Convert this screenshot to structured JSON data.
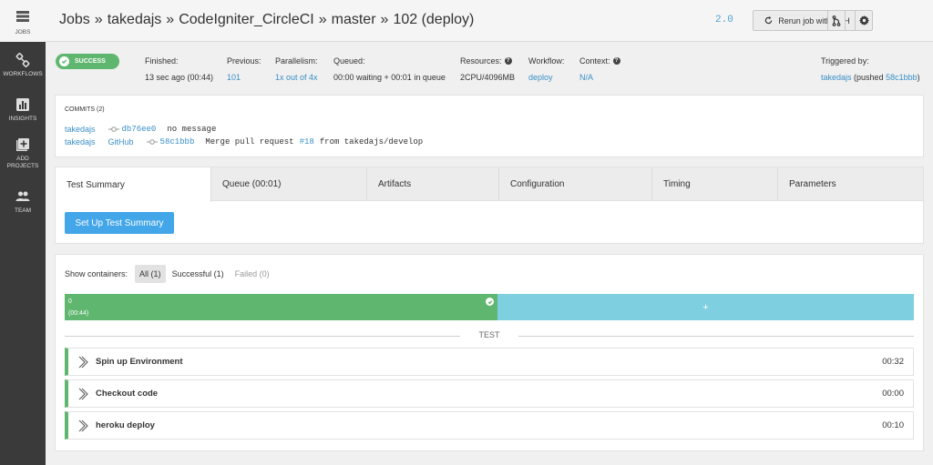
{
  "sidebar": {
    "items": [
      {
        "label": "JOBS",
        "icon": "jobs-icon"
      },
      {
        "label": "WORKFLOWS",
        "icon": "workflows-icon"
      },
      {
        "label": "INSIGHTS",
        "icon": "insights-icon"
      },
      {
        "label": "ADD PROJECTS",
        "icon": "add-projects-icon"
      },
      {
        "label": "TEAM",
        "icon": "team-icon"
      }
    ]
  },
  "header": {
    "crumbs": [
      "Jobs",
      "takedajs",
      "CodeIgniter_CircleCI",
      "master",
      "102 (deploy)"
    ],
    "separator": "»",
    "version": "2.0",
    "rerun_label": "Rerun job with SSH"
  },
  "info": {
    "status": "SUCCESS",
    "finished_label": "Finished:",
    "finished_value": "13 sec ago (00:44)",
    "previous_label": "Previous:",
    "previous_value": "101",
    "parallelism_label": "Parallelism:",
    "parallelism_value": "1x out of 4x",
    "queued_label": "Queued:",
    "queued_value": "00:00 waiting + 00:01 in queue",
    "resources_label": "Resources:",
    "resources_value": "2CPU/4096MB",
    "workflow_label": "Workflow:",
    "workflow_value": "deploy",
    "context_label": "Context:",
    "context_value": "N/A",
    "triggered_label": "Triggered by:",
    "triggered_user": "takedajs",
    "triggered_pushed": "(pushed",
    "triggered_hash": "58c1bbb",
    "triggered_close": ")"
  },
  "commits": {
    "title": "COMMITS (2)",
    "rows": [
      {
        "author": "takedajs",
        "source": "",
        "hash": "db76ee0",
        "message_pre": "no message",
        "pr": "",
        "message_post": ""
      },
      {
        "author": "takedajs",
        "source": "GitHub",
        "hash": "58c1bbb",
        "message_pre": "Merge pull request",
        "pr": "#18",
        "message_post": "from takedajs/develop"
      }
    ]
  },
  "tabs": [
    {
      "label": "Test Summary",
      "active": true
    },
    {
      "label": "Queue (00:01)",
      "active": false
    },
    {
      "label": "Artifacts",
      "active": false
    },
    {
      "label": "Configuration",
      "active": false
    },
    {
      "label": "Timing",
      "active": false
    },
    {
      "label": "Parameters",
      "active": false
    }
  ],
  "setup_button": "Set Up Test Summary",
  "containers": {
    "label": "Show containers:",
    "filters": [
      {
        "label": "All (1)",
        "state": "active"
      },
      {
        "label": "Successful (1)",
        "state": "normal"
      },
      {
        "label": "Failed (0)",
        "state": "muted"
      }
    ],
    "bar_index": "0",
    "bar_time": "(00:44)",
    "add_label": "+",
    "section_label": "TEST"
  },
  "steps": [
    {
      "name": "Spin up Environment",
      "time": "00:32"
    },
    {
      "name": "Checkout code",
      "time": "00:00"
    },
    {
      "name": "heroku deploy",
      "time": "00:10"
    }
  ],
  "colors": {
    "success": "#5fb76f",
    "link": "#3a8fc7",
    "primary_button": "#43a6e8",
    "container_add": "#7ecfe0",
    "sidebar": "#3a3a3a"
  }
}
